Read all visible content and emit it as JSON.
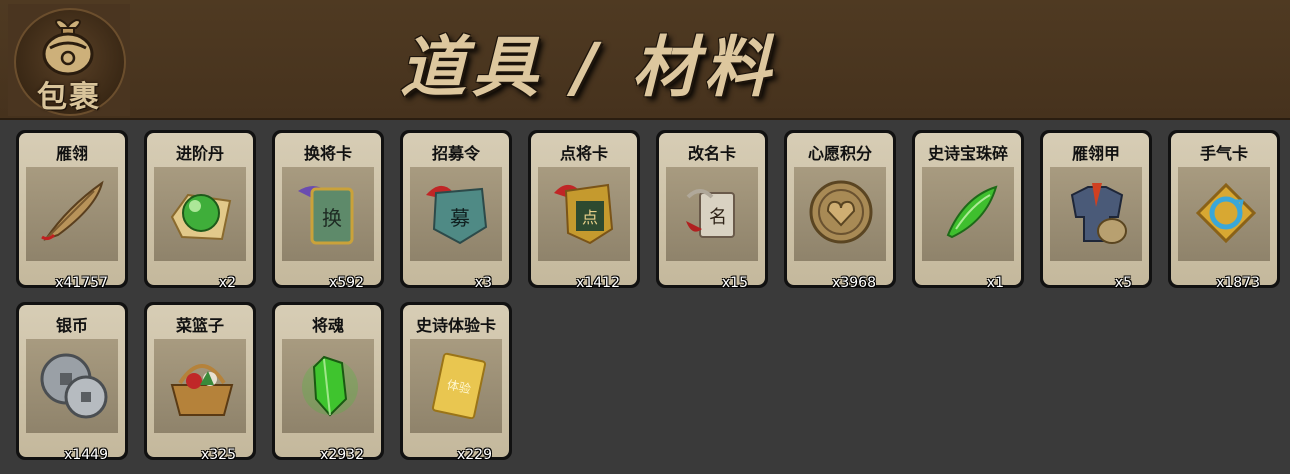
{
  "header": {
    "badge_label": "包裹",
    "title": "道具 / 材料"
  },
  "items": [
    {
      "name": "雁翎",
      "count": "x41757",
      "icon": "feather-icon",
      "color": "#b8935a"
    },
    {
      "name": "进阶丹",
      "count": "x2",
      "icon": "green-orb-icon",
      "color": "#3fae3a"
    },
    {
      "name": "换将卡",
      "count": "x592",
      "icon": "swap-general-card-icon",
      "color": "#5e8a6a"
    },
    {
      "name": "招募令",
      "count": "x3",
      "icon": "recruit-token-icon",
      "color": "#4f8a85"
    },
    {
      "name": "点将卡",
      "count": "x1412",
      "icon": "select-general-card-icon",
      "color": "#c59a2e"
    },
    {
      "name": "改名卡",
      "count": "x15",
      "icon": "rename-scroll-icon",
      "color": "#b0a89a"
    },
    {
      "name": "心愿积分",
      "count": "x3968",
      "icon": "heart-coin-icon",
      "color": "#a88a55"
    },
    {
      "name": "史诗宝珠碎",
      "count": "x1",
      "icon": "green-shard-icon",
      "color": "#3fbf2e"
    },
    {
      "name": "雁翎甲",
      "count": "x5",
      "icon": "armor-icon",
      "color": "#4a5a78"
    },
    {
      "name": "手气卡",
      "count": "x1873",
      "icon": "luck-card-icon",
      "color": "#d8a832"
    },
    {
      "name": "银币",
      "count": "x1449",
      "icon": "silver-coins-icon",
      "color": "#9aa0a6"
    },
    {
      "name": "菜篮子",
      "count": "x325",
      "icon": "basket-icon",
      "color": "#b5823a"
    },
    {
      "name": "将魂",
      "count": "x2932",
      "icon": "soul-crystal-icon",
      "color": "#3fc42e"
    },
    {
      "name": "史诗体验卡",
      "count": "x229",
      "icon": "gold-card-icon",
      "color": "#e9c650"
    }
  ]
}
